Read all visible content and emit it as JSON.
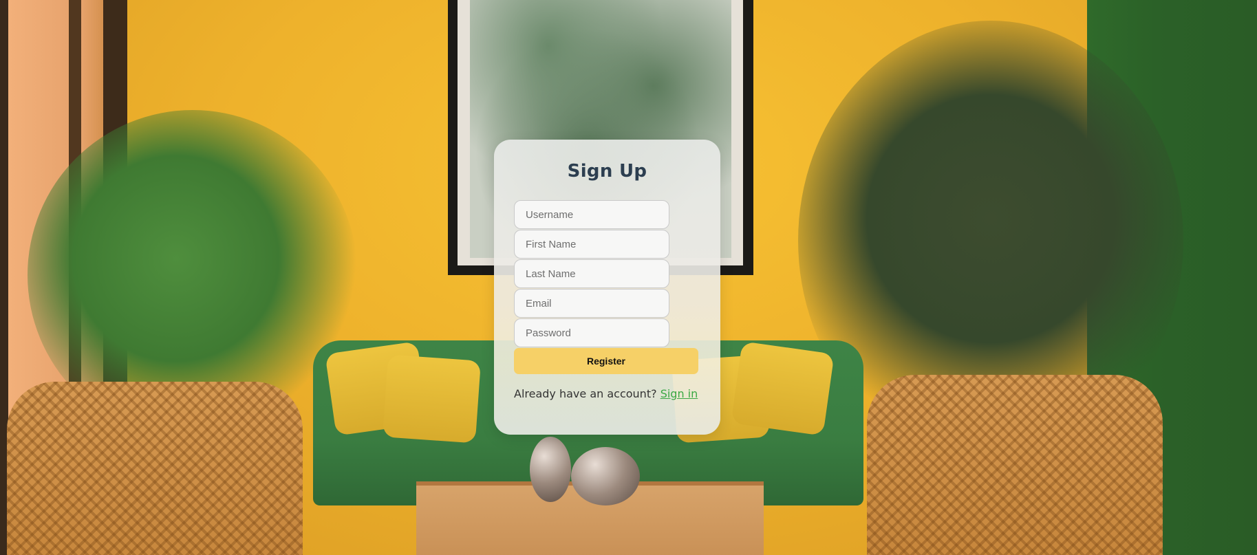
{
  "form": {
    "title": "Sign Up",
    "fields": [
      {
        "name": "username",
        "placeholder": "Username"
      },
      {
        "name": "first_name",
        "placeholder": "First Name"
      },
      {
        "name": "last_name",
        "placeholder": "Last Name"
      },
      {
        "name": "email",
        "placeholder": "Email"
      },
      {
        "name": "password",
        "placeholder": "Password"
      }
    ],
    "register_label": "Register",
    "signin_prompt": "Already have an account?",
    "signin_link": "Sign in"
  },
  "colors": {
    "title": "#2c3e50",
    "register_button": "#f6d067",
    "signin_link": "#3aa843"
  }
}
